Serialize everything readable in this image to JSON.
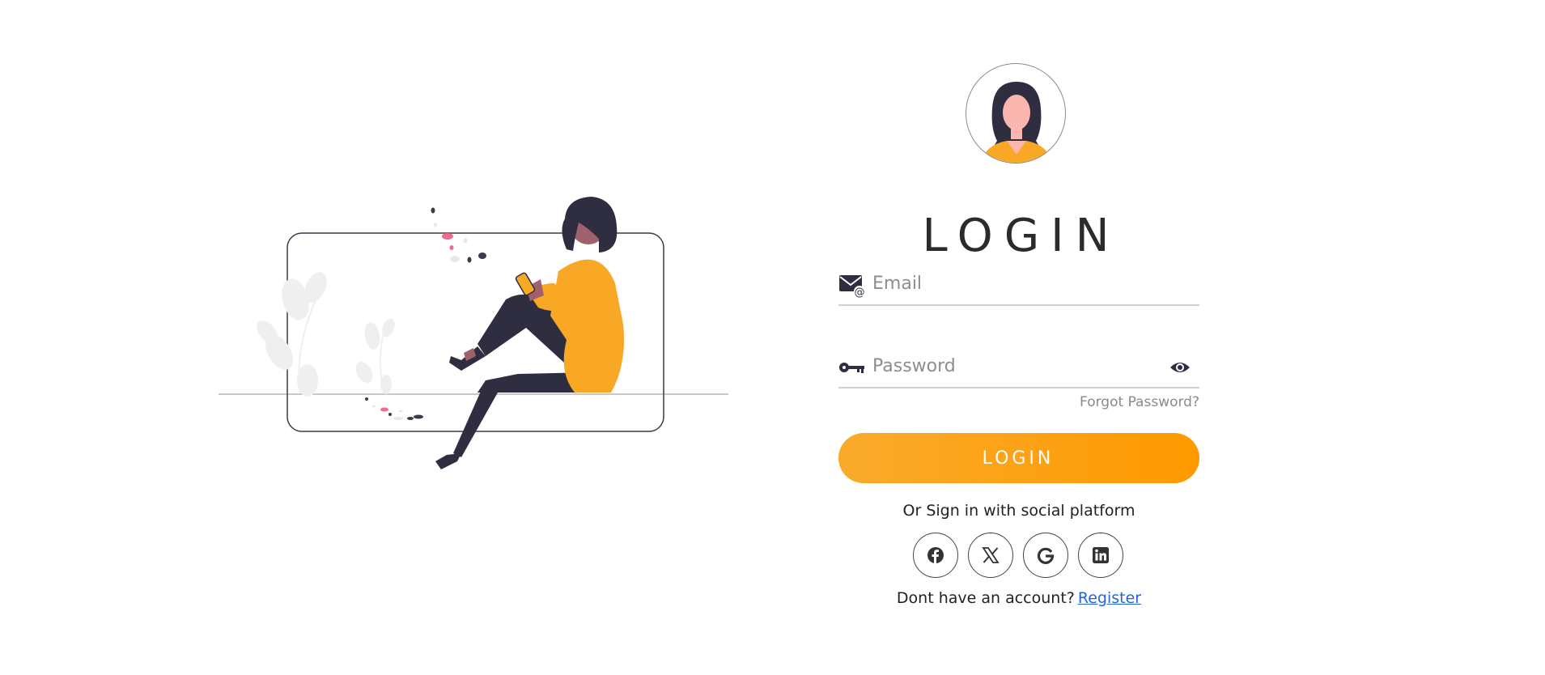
{
  "title": "LOGIN",
  "email": {
    "placeholder": "Email",
    "value": ""
  },
  "password": {
    "placeholder": "Password",
    "value": ""
  },
  "forgot_password_label": "Forgot Password?",
  "login_button_label": "LOGIN",
  "social": {
    "prompt": "Or Sign in with social platform",
    "platforms": [
      "facebook-icon",
      "x-icon",
      "google-icon",
      "linkedin-icon"
    ]
  },
  "register": {
    "prompt": "Dont have an account?",
    "link_label": "Register"
  },
  "colors": {
    "accent": "#f9a826",
    "accent_end": "#ff9a00",
    "text_dark": "#2b2b2b",
    "link": "#2266dd",
    "muted": "#8a8a8a"
  }
}
